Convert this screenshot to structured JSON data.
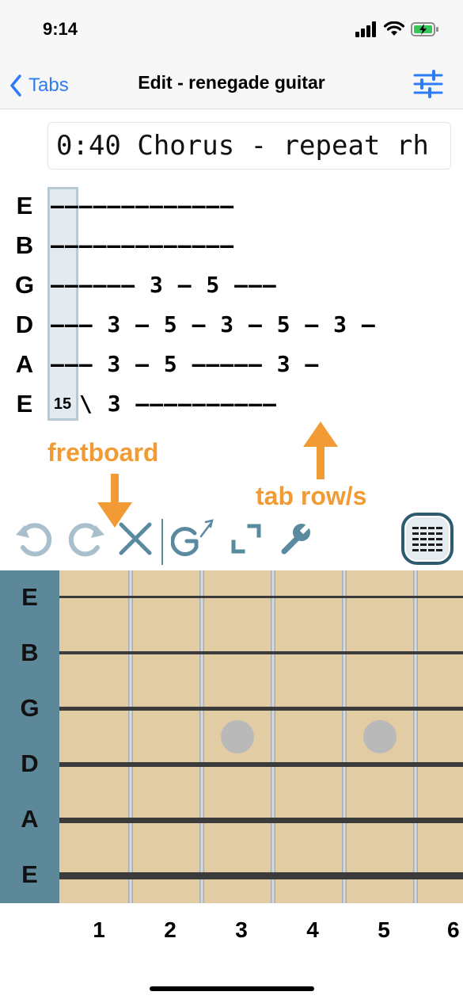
{
  "status_bar": {
    "time": "9:14"
  },
  "nav": {
    "back_label": "Tabs",
    "title": "Edit - renegade guitar"
  },
  "section_name": "0:40 Chorus - repeat rh",
  "tab": {
    "cursor_value": "15",
    "strings": [
      "E",
      "B",
      "G",
      "D",
      "A",
      "E"
    ],
    "lines": [
      "—————————————",
      "—————————————",
      "—————— 3 — 5 ———",
      "——— 3 — 5 — 3 — 5 — 3 —",
      "——— 3 — 5 ————— 3 —",
      " \\ 3 ——————————"
    ]
  },
  "annotations": {
    "fretboard": "fretboard",
    "tab_rows": "tab row/s"
  },
  "fretboard": {
    "strings": [
      "E",
      "B",
      "G",
      "D",
      "A",
      "E"
    ],
    "fret_numbers": [
      "1",
      "2",
      "3",
      "4",
      "5",
      "6"
    ]
  },
  "toolbar": {
    "icons": [
      "undo-icon",
      "redo-icon",
      "delete-icon",
      "guitar-mode-icon",
      "expand-icon",
      "wrench-icon",
      "keyboard-icon"
    ]
  },
  "colors": {
    "accent": "#2d7cf6",
    "annotation": "#f29b34",
    "nut": "#5d8899",
    "wood": "#e2cca4",
    "tool": "#5a8aa0"
  }
}
